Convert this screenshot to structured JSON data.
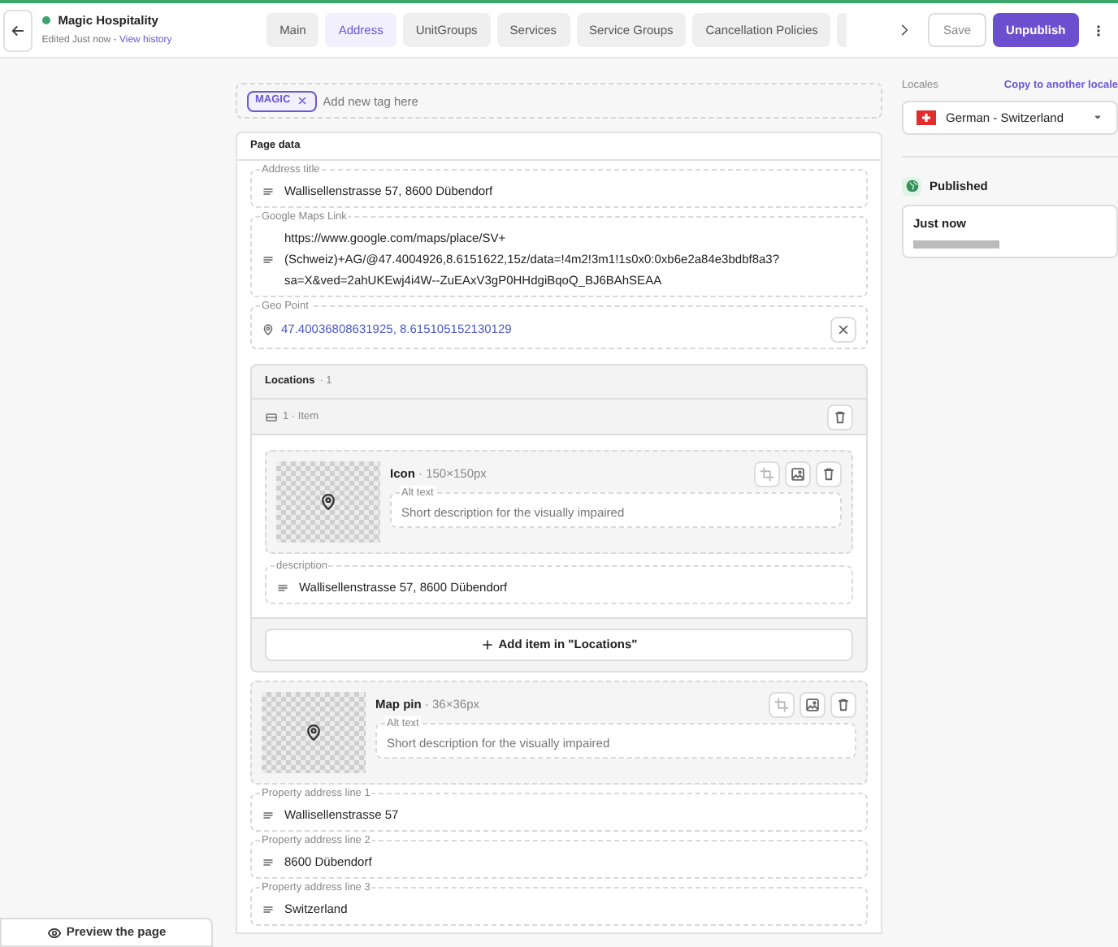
{
  "header": {
    "title": "Magic Hospitality",
    "online": true,
    "edited": "Edited Just now - ",
    "history_link": "View history"
  },
  "tabs": [
    {
      "label": "Main",
      "selected": false
    },
    {
      "label": "Address",
      "selected": true
    },
    {
      "label": "UnitGroups",
      "selected": false
    },
    {
      "label": "Services",
      "selected": false
    },
    {
      "label": "Service Groups",
      "selected": false
    },
    {
      "label": "Cancellation Policies",
      "selected": false
    }
  ],
  "actions": {
    "save": "Save",
    "unpublish": "Unpublish"
  },
  "tags": [
    {
      "label": "MAGIC"
    }
  ],
  "tag_input": {
    "placeholder": "Add new tag here"
  },
  "page_data": {
    "title": "Page data",
    "fields": [
      {
        "kind": "text",
        "label": "Address title",
        "value": "Wallisellenstrasse 57, 8600 Dübendorf"
      },
      {
        "kind": "text",
        "label": "Google Maps Link",
        "value": "https://www.google.com/maps/place/SV+(Schweiz)+AG/@47.4004926,8.6151622,15z/data=!4m2!3m1!1s0x0:0xb6e2a84e3bdbf8a3?sa=X&ved=2ahUKEwj4i4W--ZuEAxV3gP0HHdgiBqoQ_BJ6BAhSEAA"
      },
      {
        "kind": "geo",
        "label": "Geo Point",
        "value": "47.40036808631925, 8.615105152130129"
      },
      {
        "kind": "repeater",
        "label": "Locations",
        "count": "· 1",
        "add_label": "Add item in \"Locations\"",
        "items": [
          {
            "label": "1 · Item",
            "fields": [
              {
                "kind": "image",
                "label": "Icon",
                "size": "· 150×150px",
                "alt_label": "Alt text",
                "alt_placeholder": "Short description for the visually impaired"
              },
              {
                "kind": "text",
                "label": "description",
                "value": "Wallisellenstrasse 57, 8600 Dübendorf"
              }
            ]
          }
        ]
      },
      {
        "kind": "image",
        "label": "Map pin",
        "size": "· 36×36px",
        "alt_label": "Alt text",
        "alt_placeholder": "Short description for the visually impaired"
      },
      {
        "kind": "text",
        "label": "Property address line 1",
        "value": "Wallisellenstrasse 57"
      },
      {
        "kind": "text",
        "label": "Property address line 2",
        "value": "8600 Dübendorf"
      },
      {
        "kind": "text",
        "label": "Property address line 3",
        "value": "Switzerland"
      }
    ]
  },
  "sidebar": {
    "locales_label": "Locales",
    "copy_link": "Copy to another locale",
    "locale": "German - Switzerland",
    "status": "Published",
    "published_time": "Just now"
  },
  "preview_button": "Preview the page"
}
